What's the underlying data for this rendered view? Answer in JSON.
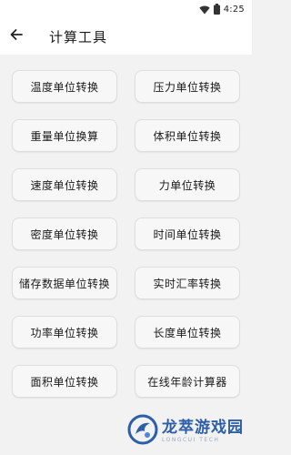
{
  "status_bar": {
    "time": "4:25"
  },
  "app_bar": {
    "title": "计算工具"
  },
  "tools": [
    "温度单位转换",
    "压力单位转换",
    "重量单位换算",
    "体积单位转换",
    "速度单位转换",
    "力单位转换",
    "密度单位转换",
    "时间单位转换",
    "储存数据单位转换",
    "实时汇率转换",
    "功率单位转换",
    "长度单位转换",
    "面积单位转换",
    "在线年龄计算器"
  ],
  "watermark": {
    "title": "龙萃游戏园",
    "subtitle": "LONGCUI TECH"
  },
  "colors": {
    "watermark_blue": "#2c5eaa",
    "background": "#f2f2f2"
  }
}
